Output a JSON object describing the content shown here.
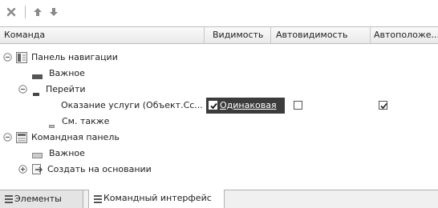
{
  "toolbar": {
    "buttons": [
      {
        "icon": "close-icon"
      },
      {
        "icon": "move-up-icon"
      },
      {
        "icon": "move-down-icon"
      }
    ]
  },
  "columns": [
    "Команда",
    "Видимость",
    "Автовидимость",
    "Автоположе..."
  ],
  "tree": [
    {
      "label": "Панель навигации",
      "expander": "minus",
      "icon": "navigation-panel-icon"
    },
    {
      "label": "Важное",
      "icon": "group-icon"
    },
    {
      "label": "Перейти",
      "expander": "minus",
      "icon": "group-small-icon"
    },
    {
      "label": "Оказание услуги (Объект.Сс...",
      "visibility_label": "Одинаковая",
      "visibility_checked": true,
      "autovisibility_checked": false,
      "autoposition_checked": true
    },
    {
      "label": "См. также",
      "icon": "group-small-icon"
    },
    {
      "label": "Командная панель",
      "expander": "minus",
      "icon": "command-panel-icon"
    },
    {
      "label": "Важное",
      "icon": "group-icon"
    },
    {
      "label": "Создать на основании",
      "expander": "plus",
      "icon": "create-based-on-icon"
    }
  ],
  "tabs": [
    {
      "label": "Элементы",
      "icon": "elements-icon",
      "active": false
    },
    {
      "label": "Командный интерфейс",
      "icon": "command-interface-icon",
      "active": true
    }
  ],
  "colors": {
    "accent_selected": "#3c3c3c",
    "header_bg": "#eeeeee"
  }
}
